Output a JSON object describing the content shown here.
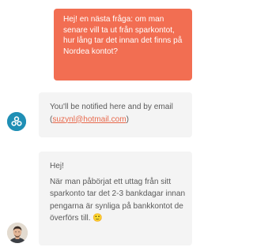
{
  "messages": {
    "user": {
      "text": "Hej! en nästa fråga: om man senare vill ta ut från sparkontot, hur lång tar det innan det finns på Nordea kontot?"
    },
    "bot": {
      "text_before": "You'll be notified here and by email (",
      "email": "suzynl@hotmail.com",
      "text_after": ")",
      "avatar_icon": "bubbles-icon"
    },
    "agent": {
      "greeting": "Hej!",
      "text": "När man påbörjat ett uttag från sitt sparkonto tar det 2-3 bankdagar innan pengarna är synliga på bankkontot de överförs till. 🙂",
      "avatar": "agent-photo"
    }
  },
  "colors": {
    "user_bubble": "#f26e52",
    "bot_bubble": "#f4f4f4",
    "link": "#e8694c",
    "bot_avatar": "#1f8fb5"
  }
}
